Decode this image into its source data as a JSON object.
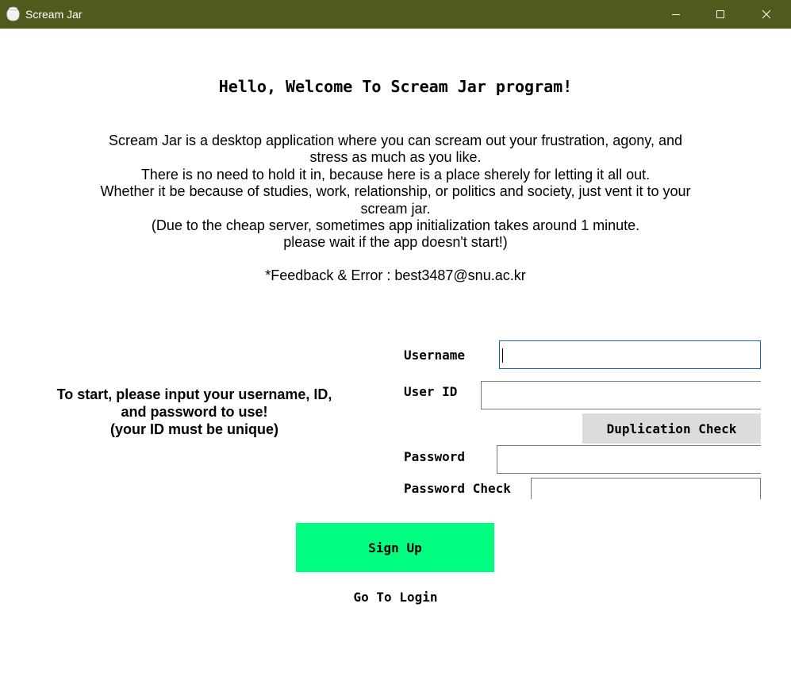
{
  "window": {
    "title": "Scream Jar",
    "icon": "jar-icon",
    "titlebar_color": "#4f5b1c",
    "controls": [
      "minimize-icon",
      "maximize-icon",
      "close-icon"
    ]
  },
  "intro": {
    "welcome": "Hello, Welcome To Scream Jar program!",
    "description_lines": [
      "Scream Jar is a desktop application where you can scream out your frustration, agony, and",
      "stress as much as you like.",
      "There is no need to hold it in, because here is a place sherely for letting it all out.",
      "Whether it be because of studies, work, relationship, or politics and society, just vent it to your",
      "scream jar.",
      "(Due to the cheap server, sometimes app initialization takes around 1 minute.",
      "please wait if the app doesn't start!)"
    ],
    "feedback": "*Feedback & Error : best3487@snu.ac.kr"
  },
  "instructions": {
    "lines": [
      "To start, please input your username, ID,",
      "and password to use!",
      "(your ID must be unique)"
    ]
  },
  "form": {
    "username_label": "Username",
    "username_value": "",
    "userid_label": "User ID",
    "userid_value": "",
    "duplication_check_label": "Duplication Check",
    "password_label": "Password",
    "password_value": "",
    "password_check_label": "Password Check",
    "password_check_value": ""
  },
  "actions": {
    "signup_label": "Sign Up",
    "signup_color": "#00ff80",
    "go_to_login_label": "Go To Login"
  }
}
